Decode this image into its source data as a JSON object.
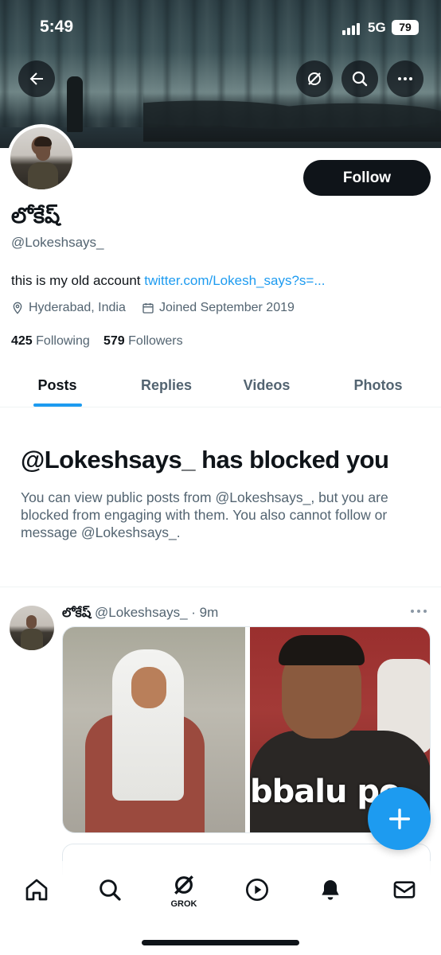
{
  "status_bar": {
    "time": "5:49",
    "network": "5G",
    "battery": "79"
  },
  "profile": {
    "display_name": "లోకేష్",
    "handle": "@Lokeshsays_",
    "bio_text": "this is my old account ",
    "bio_link": "twitter.com/Lokesh_says?s=...",
    "location": "Hyderabad, India",
    "joined": "Joined September 2019",
    "following_count": "425",
    "following_label": "Following",
    "followers_count": "579",
    "followers_label": "Followers",
    "follow_button": "Follow"
  },
  "header_icons": [
    "back-arrow-icon",
    "grok-icon",
    "search-icon",
    "more-icon"
  ],
  "tabs": [
    {
      "label": "Posts",
      "active": true
    },
    {
      "label": "Replies",
      "active": false
    },
    {
      "label": "Videos",
      "active": false
    },
    {
      "label": "Photos",
      "active": false
    }
  ],
  "blocked": {
    "title": "@Lokeshsays_ has blocked you",
    "text": "You can view public posts from @Lokeshsays_, but you are blocked from engaging with them. You also cannot follow or message @Lokeshsays_."
  },
  "post": {
    "author_name": "లోకేష్",
    "author_handle": "@Lokeshsays_",
    "time": "· 9m",
    "image_caption": "bbalu po"
  },
  "bottom_nav": {
    "grok_label": "GROK",
    "items": [
      "home-icon",
      "search-icon",
      "grok-icon",
      "play-icon",
      "notifications-icon",
      "messages-icon"
    ]
  },
  "colors": {
    "accent": "#1d9bf0",
    "text": "#0f1419",
    "muted": "#536471"
  }
}
